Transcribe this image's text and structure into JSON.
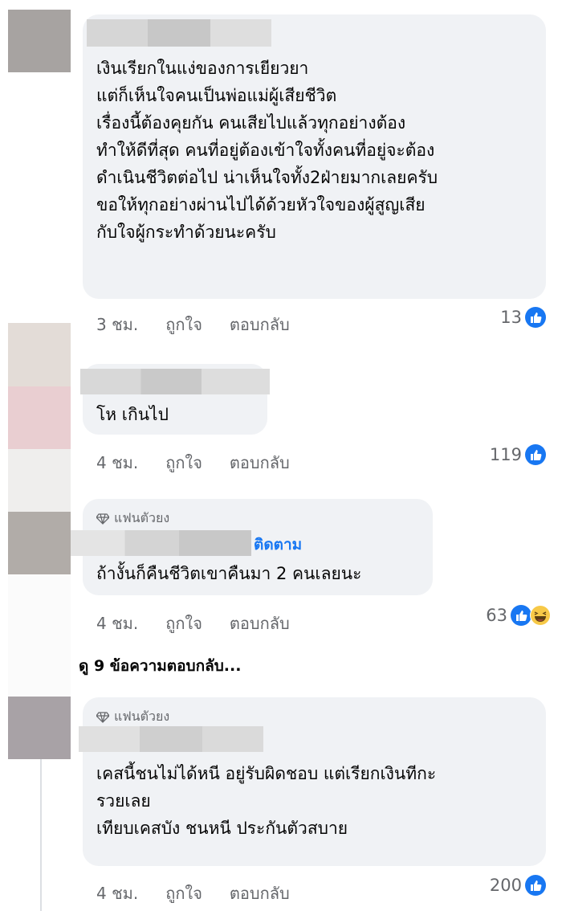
{
  "comments": [
    {
      "text": "เงินเรียกในแง่ของการเยียวยา\nแต่ก็เห็นใจคนเป็นพ่อแม่ผู้เสียชีวิต\nเรื่องนี้ต้องคุยกัน คนเสียไปแล้วทุกอย่างต้อง\nทำให้ดีที่สุด คนที่อยู่ต้องเข้าใจทั้งคนที่อยู่จะต้อง\nดำเนินชีวิตต่อไป น่าเห็นใจทั้ง2ฝ่ายมากเลยครับ\nขอให้ทุกอย่างผ่านไปได้ด้วยหัวใจของผู้สูญเสีย\nกับใจผู้กระทำด้วยนะครับ",
      "time": "3 ชม.",
      "like_label": "ถูกใจ",
      "reply_label": "ตอบกลับ",
      "reaction_count": "13"
    },
    {
      "text": "โห เกินไป",
      "time": "4 ชม.",
      "like_label": "ถูกใจ",
      "reply_label": "ตอบกลับ",
      "reaction_count": "119"
    },
    {
      "badge": "แฟนตัวยง",
      "follow_label": "ติดตาม",
      "text": "ถ้างั้นก็คืนชีวิตเขาคืนมา 2 คนเลยนะ",
      "time": "4 ชม.",
      "like_label": "ถูกใจ",
      "reply_label": "ตอบกลับ",
      "reaction_count": "63"
    },
    {
      "badge": "แฟนตัวยง",
      "text": "เคสนี้ชนไม่ได้หนี อยู่รับผิดชอบ แต่เรียกเงินทีกะ\nรวยเลย\nเทียบเคสบัง ชนหนี ประกันตัวสบาย",
      "time": "4 ชม.",
      "like_label": "ถูกใจ",
      "reply_label": "ตอบกลับ",
      "reaction_count": "200"
    }
  ],
  "view_more_replies": "ดู 9 ข้อความตอบกลับ...",
  "icons": {
    "like": "like-icon",
    "haha": "haha-icon",
    "badge": "diamond-icon"
  },
  "colors": {
    "bubble": "#f0f2f5",
    "like_blue": "#1877f2",
    "meta_gray": "#65676b",
    "haha_yellow": "#f7c948"
  }
}
